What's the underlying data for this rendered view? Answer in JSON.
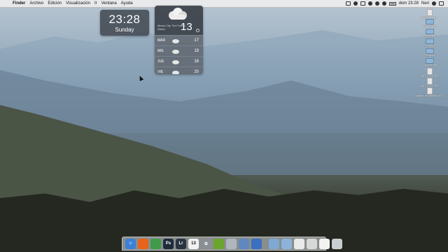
{
  "menubar": {
    "apple_glyph": "",
    "menus": [
      "Finder",
      "Archivo",
      "Edición",
      "Visualización",
      "Ir",
      "Ventana",
      "Ayuda"
    ],
    "clock": "dom 23:28",
    "user": "Neri"
  },
  "clock_widget": {
    "time": "23:28",
    "day": "Sunday"
  },
  "weather_widget": {
    "location": "Mexico City, The Federal District",
    "temperature": "13",
    "forecast": [
      {
        "day": "MAR",
        "temp": "17"
      },
      {
        "day": "MIE",
        "temp": "19"
      },
      {
        "day": "JUE",
        "temp": "16"
      },
      {
        "day": "VIE",
        "temp": "20"
      }
    ]
  },
  "desktop_icons": [
    {
      "label": "Captura de p...",
      "type": "file"
    },
    {
      "label": "ACM Folder",
      "type": "folder"
    },
    {
      "label": "Descargas",
      "type": "folder"
    },
    {
      "label": "Dropbox",
      "type": "folder"
    },
    {
      "label": "Proyecto",
      "type": "folder"
    },
    {
      "label": "Documentos",
      "type": "folder"
    },
    {
      "label": "IMG_0124.JPG",
      "type": "file"
    },
    {
      "label": "IMG_0125.JPG",
      "type": "file"
    },
    {
      "label": "Captura de pantalla 2013-09...",
      "type": "file"
    }
  ],
  "dock": {
    "apps": [
      {
        "name": "finder-icon",
        "color": "#3c7fd6",
        "glyph": "☺"
      },
      {
        "name": "firefox-icon",
        "color": "#e8631c",
        "glyph": ""
      },
      {
        "name": "chrome-icon",
        "color": "#3f9a4a",
        "glyph": ""
      },
      {
        "name": "photoshop-icon",
        "color": "#1d2b3a",
        "glyph": "Ps"
      },
      {
        "name": "lightroom-icon",
        "color": "#2a3442",
        "glyph": "Lr"
      },
      {
        "name": "calendar-icon",
        "color": "#f2f2f2",
        "glyph": "13"
      },
      {
        "name": "system-preferences-icon",
        "color": "#8a8f95",
        "glyph": "⚙"
      },
      {
        "name": "spotify-icon",
        "color": "#6aa62e",
        "glyph": ""
      },
      {
        "name": "sparrow-icon",
        "color": "#b0b6bd",
        "glyph": ""
      },
      {
        "name": "mail-icon",
        "color": "#5f88c0",
        "glyph": ""
      },
      {
        "name": "itunes-icon",
        "color": "#3b6fc0",
        "glyph": ""
      },
      {
        "name": "applications-folder-icon",
        "color": "#7fa8d4",
        "glyph": ""
      },
      {
        "name": "documents-folder-icon",
        "color": "#8cb3da",
        "glyph": ""
      },
      {
        "name": "downloads-stack-icon",
        "color": "#e9e9e9",
        "glyph": ""
      },
      {
        "name": "preview-stack-icon",
        "color": "#d8d8d8",
        "glyph": ""
      },
      {
        "name": "file-stack-icon",
        "color": "#f3f3f3",
        "glyph": ""
      },
      {
        "name": "trash-icon",
        "color": "#c8cdd2",
        "glyph": ""
      }
    ]
  }
}
